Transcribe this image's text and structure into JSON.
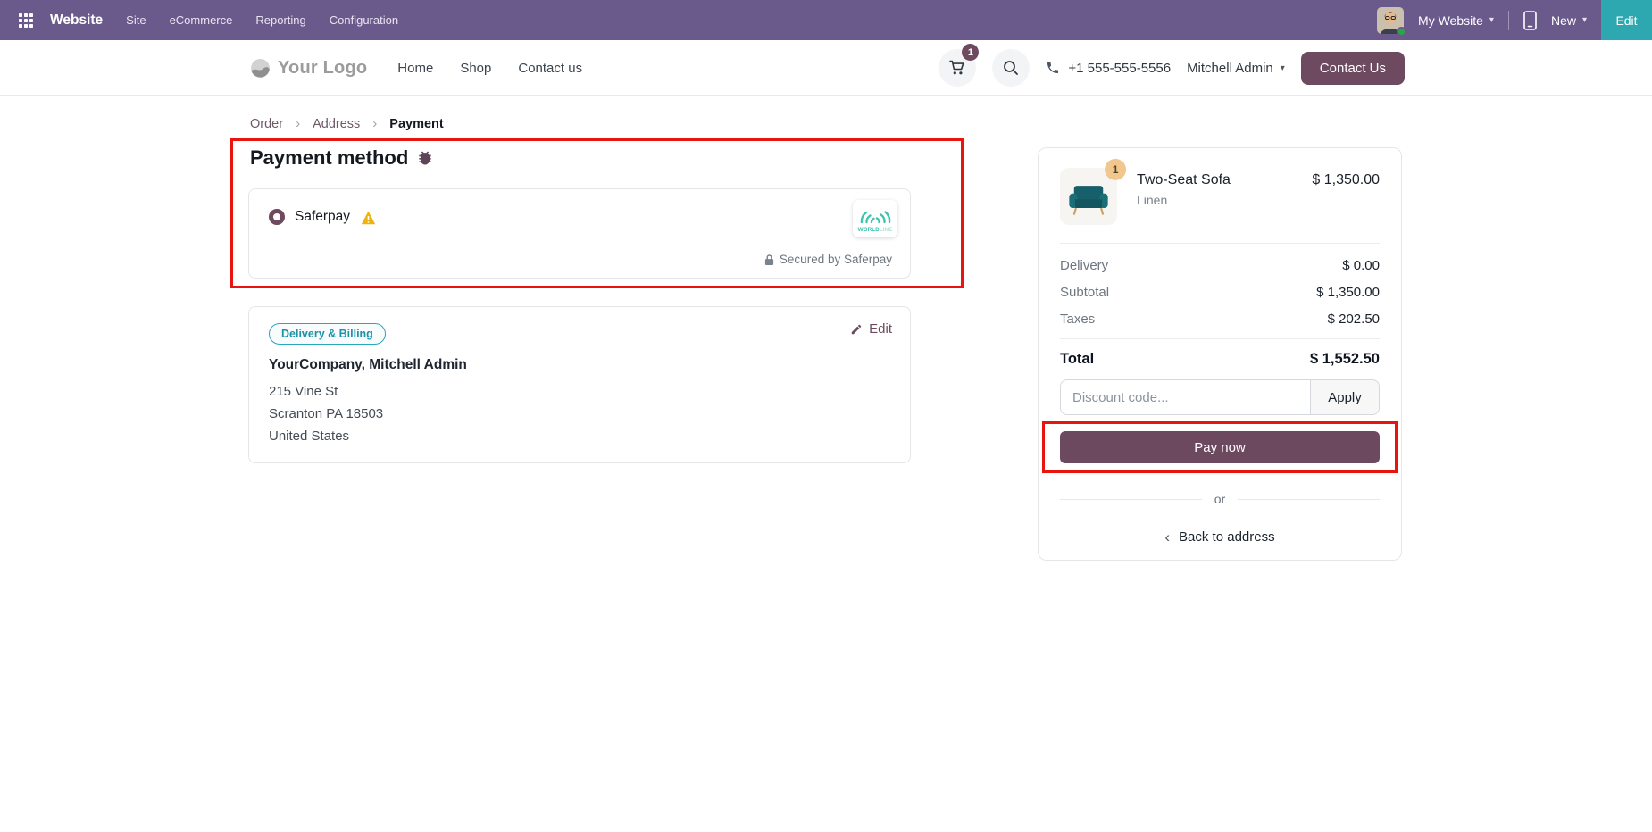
{
  "topbar": {
    "app_name": "Website",
    "menus": [
      "Site",
      "eCommerce",
      "Reporting",
      "Configuration"
    ],
    "website_switcher": "My Website",
    "new_label": "New",
    "edit_label": "Edit"
  },
  "header": {
    "logo_text": "Your Logo",
    "nav": [
      "Home",
      "Shop",
      "Contact us"
    ],
    "cart_count": "1",
    "phone": "+1 555-555-5556",
    "user_name": "Mitchell Admin",
    "contact_us_label": "Contact Us"
  },
  "breadcrumb": {
    "items": [
      "Order",
      "Address",
      "Payment"
    ]
  },
  "payment": {
    "title": "Payment method",
    "provider": "Saferpay",
    "secured_note": "Secured by Saferpay",
    "brand_word1": "WORLD",
    "brand_word2": "LINE"
  },
  "address_card": {
    "badge": "Delivery & Billing",
    "edit_label": "Edit",
    "name": "YourCompany, Mitchell Admin",
    "lines": [
      "215 Vine St",
      "Scranton PA 18503",
      "United States"
    ]
  },
  "order_summary": {
    "item": {
      "qty": "1",
      "name": "Two-Seat Sofa",
      "variant": "Linen",
      "price": "$ 1,350.00"
    },
    "rows": [
      {
        "label": "Delivery",
        "value": "$ 0.00"
      },
      {
        "label": "Subtotal",
        "value": "$ 1,350.00"
      },
      {
        "label": "Taxes",
        "value": "$ 202.50"
      }
    ],
    "total": {
      "label": "Total",
      "value": "$ 1,552.50"
    },
    "discount_placeholder": "Discount code...",
    "apply_label": "Apply",
    "pay_label": "Pay now",
    "or_label": "or",
    "back_label": "Back to address"
  },
  "icons": {
    "caret_down": "▾",
    "breadcrumb_sep": "›",
    "back_chevron": "‹"
  },
  "colors": {
    "topbar": "#6a5a8c",
    "edit_button": "#2ea8b0",
    "primary": "#6d4a5f",
    "pay_button": "#6d4960",
    "badge_teal": "#28a7bd",
    "warning": "#efb310",
    "worldline_teal": "#3fc4ae",
    "annotation": "#e8140d",
    "qty_badge": "#f2c78e"
  }
}
